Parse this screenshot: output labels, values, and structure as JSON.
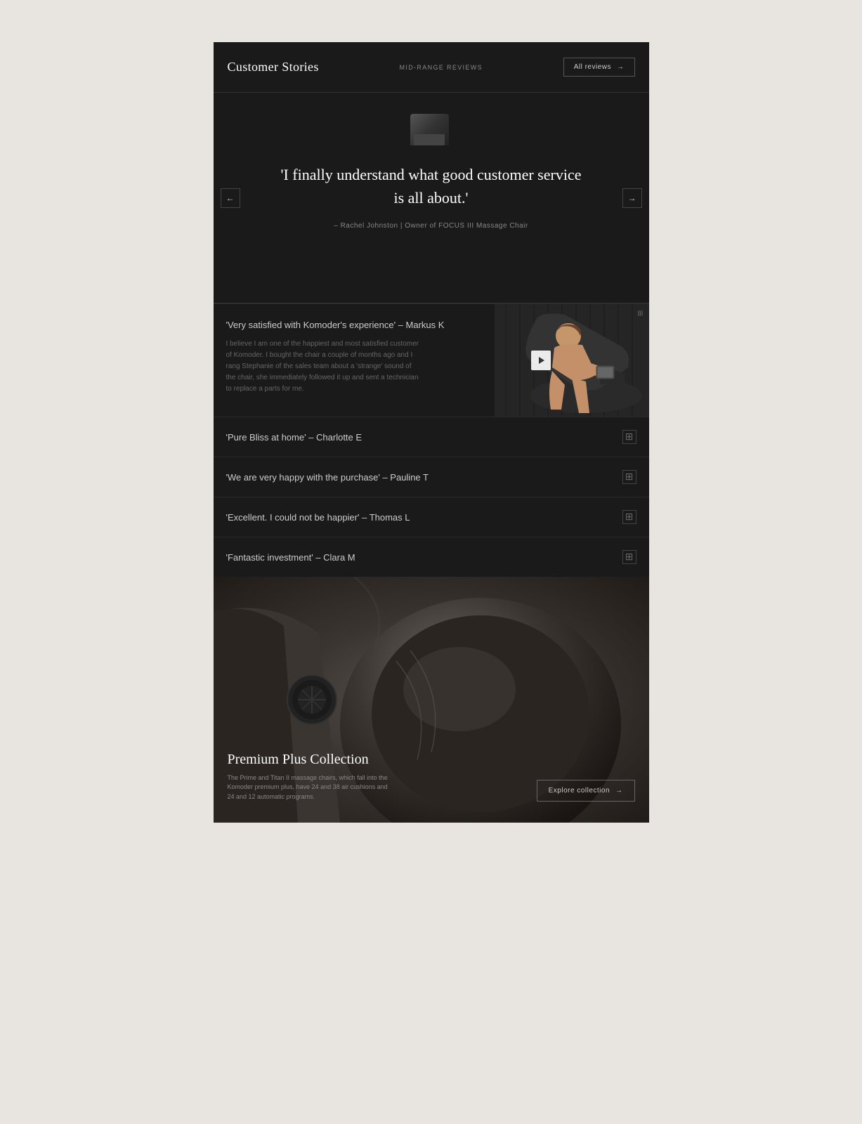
{
  "header": {
    "title": "Customer Stories",
    "center_label": "MID-RANGE REVIEWS",
    "all_reviews_label": "All reviews",
    "all_reviews_arrow": "→"
  },
  "hero": {
    "quote": "'I finally understand what good customer service is all about.'",
    "attribution": "– Rachel Johnston  |  Owner of FOCUS III Massage Chair",
    "nav_left": "←",
    "nav_right": "→"
  },
  "featured_review": {
    "title": "'Very satisfied with Komoder's experience' – Markus K",
    "body": "I believe I am one of the happiest and most satisfied customer of Komoder. I bought the chair a couple of months ago and I rang Stephanie of the sales team about a 'strange' sound of the chair, she immediately followed it up and sent a technician to replace a parts for me.",
    "expand_icon": "⊞"
  },
  "accordion_items": [
    {
      "title": "'Pure Bliss at home' – Charlotte E",
      "icon": "⊞"
    },
    {
      "title": "'We are very happy with the purchase' – Pauline T",
      "icon": "⊞"
    },
    {
      "title": "'Excellent. I could not be happier' – Thomas L",
      "icon": "⊞"
    },
    {
      "title": "'Fantastic investment' – Clara M",
      "icon": "⊞"
    }
  ],
  "bottom": {
    "title": "Premium Plus Collection",
    "description": "The Prime and Titan II massage chairs, which fall into the Komoder premium plus, have 24 and 38 air cushions and 24 and 12 automatic programs.",
    "explore_label": "Explore collection",
    "explore_arrow": "→"
  }
}
